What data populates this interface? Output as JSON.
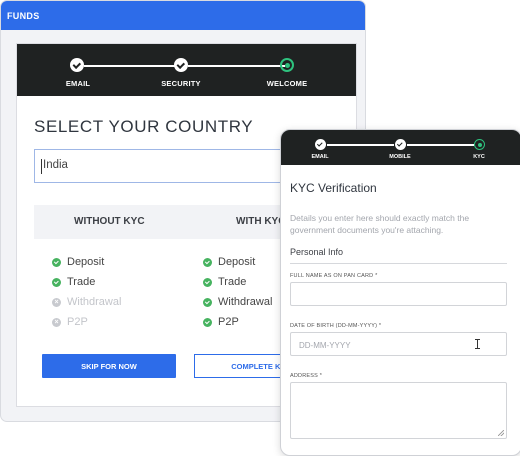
{
  "app": {
    "title": "FUNDS"
  },
  "steps": [
    {
      "label": "EMAIL",
      "state": "done"
    },
    {
      "label": "SECURITY",
      "state": "done"
    },
    {
      "label": "WELCOME",
      "state": "active"
    }
  ],
  "country": {
    "title": "SELECT YOUR COUNTRY",
    "value": "India"
  },
  "kyc_table": {
    "without_header": "WITHOUT KYC",
    "with_header": "WITH KYC",
    "without_items": [
      {
        "label": "Deposit",
        "enabled": true
      },
      {
        "label": "Trade",
        "enabled": true
      },
      {
        "label": "Withdrawal",
        "enabled": false
      },
      {
        "label": "P2P",
        "enabled": false
      }
    ],
    "with_items": [
      {
        "label": "Deposit",
        "enabled": true
      },
      {
        "label": "Trade",
        "enabled": true
      },
      {
        "label": "Withdrawal",
        "enabled": true
      },
      {
        "label": "P2P",
        "enabled": true
      }
    ]
  },
  "buttons": {
    "skip": "SKIP FOR NOW",
    "complete": "COMPLETE KYC"
  },
  "kyc_card": {
    "steps": [
      {
        "label": "EMAIL",
        "state": "done"
      },
      {
        "label": "MOBILE",
        "state": "done"
      },
      {
        "label": "KYC",
        "state": "active"
      }
    ],
    "title": "KYC Verification",
    "description": "Details you enter here should exactly match the government documents you're attaching.",
    "section": "Personal Info",
    "fields": {
      "full_name_label": "FULL NAME AS ON PAN CARD *",
      "dob_label": "DATE OF BIRTH (DD-MM-YYYY) *",
      "dob_placeholder": "DD-MM-YYYY",
      "address_label": "ADDRESS *"
    }
  },
  "colors": {
    "brand": "#2d6ce9",
    "success": "#47b360",
    "stepbar": "#1f2222",
    "active_step": "#2ec27e"
  }
}
